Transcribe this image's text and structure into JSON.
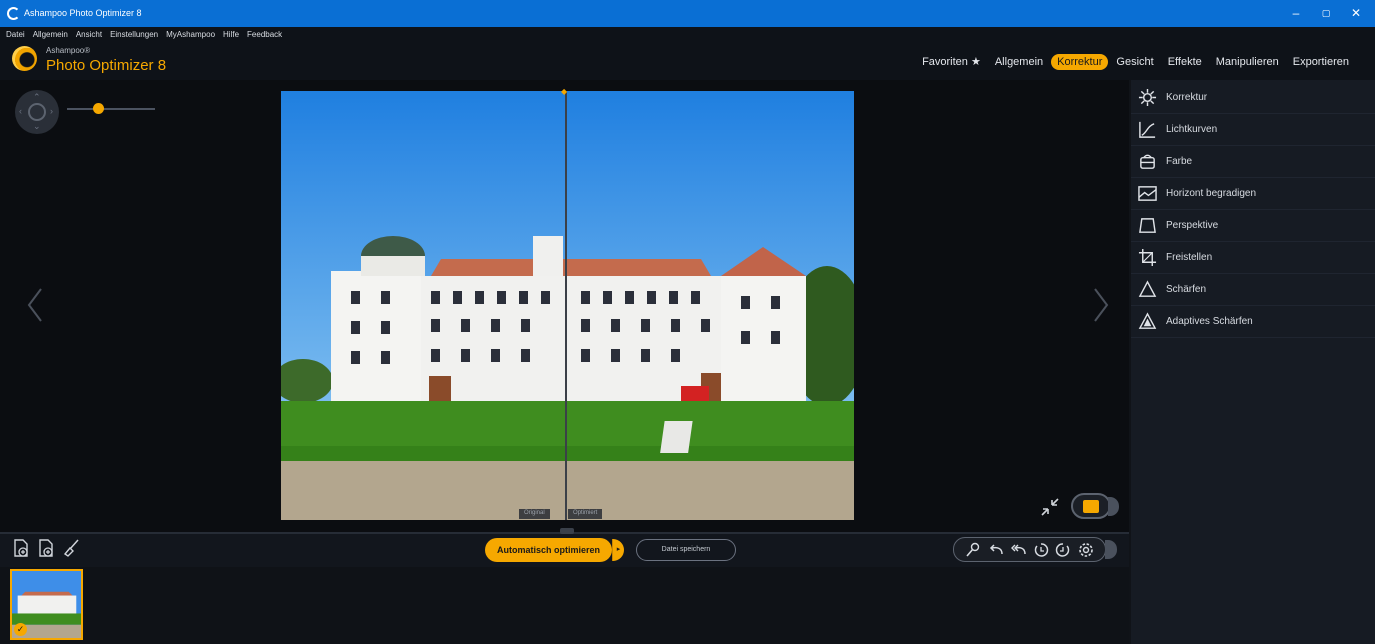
{
  "window": {
    "title": "Ashampoo Photo Optimizer 8",
    "min_glyph": "–",
    "max_glyph": "▢",
    "close_glyph": "✕"
  },
  "menu": [
    "Datei",
    "Allgemein",
    "Ansicht",
    "Einstellungen",
    "MyAshampoo",
    "Hilfe",
    "Feedback"
  ],
  "brand": {
    "small": "Ashampoo®",
    "big": "Photo Optimizer 8"
  },
  "tabs": [
    {
      "label": "Favoriten ★",
      "active": false
    },
    {
      "label": "Allgemein",
      "active": false
    },
    {
      "label": "Korrektur",
      "active": true
    },
    {
      "label": "Gesicht",
      "active": false
    },
    {
      "label": "Effekte",
      "active": false
    },
    {
      "label": "Manipulieren",
      "active": false
    },
    {
      "label": "Exportieren",
      "active": false
    }
  ],
  "side_panel": {
    "items": [
      {
        "label": "Korrektur",
        "icon": "sun-icon"
      },
      {
        "label": "Lichtkurven",
        "icon": "curves-icon"
      },
      {
        "label": "Farbe",
        "icon": "color-bucket-icon"
      },
      {
        "label": "Horizont begradigen",
        "icon": "horizon-icon"
      },
      {
        "label": "Perspektive",
        "icon": "perspective-icon"
      },
      {
        "label": "Freistellen",
        "icon": "crop-icon"
      },
      {
        "label": "Schärfen",
        "icon": "sharpen-icon"
      },
      {
        "label": "Adaptives Schärfen",
        "icon": "adaptive-sharpen-icon"
      }
    ]
  },
  "compare": {
    "left_label": "Original",
    "right_label": "Optimiert"
  },
  "zoom": {
    "level": 0.35
  },
  "bottom": {
    "auto_button": "Automatisch optimieren",
    "auto_dropdown": "▸",
    "save_button": "Datei speichern"
  },
  "colors": {
    "accent": "#f6a800",
    "titlebar": "#0a6fd4",
    "background": "#101318"
  }
}
